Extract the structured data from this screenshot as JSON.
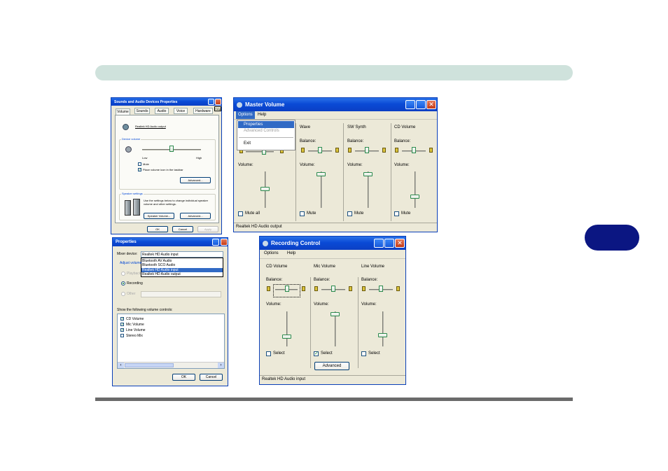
{
  "sounds": {
    "title": "Sounds and Audio Devices Properties",
    "help": "Help",
    "tabs": [
      "Volume",
      "Sounds",
      "Audio",
      "Voice",
      "Hardware"
    ],
    "device": "Realtek HD Audio output",
    "device_volume": "Device volume",
    "low": "Low",
    "high": "High",
    "mute": "Mute",
    "place_icon": "Place volume icon in the taskbar",
    "advanced": "Advanced...",
    "speaker_settings": "Speaker settings",
    "speaker_text": "Use the settings below to change individual speaker volume and other settings.",
    "speaker_volume": "Speaker Volume...",
    "advanced2": "Advanced...",
    "ok": "OK",
    "cancel": "Cancel",
    "apply": "Apply"
  },
  "master": {
    "title": "Master Volume",
    "menu": [
      "Options",
      "Help"
    ],
    "dropdown": [
      "Properties",
      "Advanced Controls",
      "Exit"
    ],
    "columns": [
      "Wave",
      "SW Synth",
      "CD Volume"
    ],
    "balance": "Balance:",
    "volume": "Volume:",
    "mute_all": "Mute all",
    "mute": "Mute",
    "status": "Realtek HD Audio output"
  },
  "props": {
    "title": "Properties",
    "mixer_label": "Mixer device:",
    "mixer_value": "Realtek HD Audio input",
    "mixer_options": [
      "Bluetooth AV Audio",
      "Bluetooth SCO Audio",
      "Realtek HD Audio input",
      "Realtek HD Audio output"
    ],
    "adjust": "Adjust volume",
    "playback": "Playback",
    "recording": "Recording",
    "other": "Other",
    "show": "Show the following volume controls:",
    "controls": [
      "CD Volume",
      "Mic Volume",
      "Line Volume",
      "Stereo Mix"
    ],
    "ok": "OK",
    "cancel": "Cancel"
  },
  "recording": {
    "title": "Recording Control",
    "menu": [
      "Options",
      "Help"
    ],
    "columns": [
      "CD Volume",
      "Mic Volume",
      "Line Volume"
    ],
    "balance": "Balance:",
    "volume": "Volume:",
    "select": "Select",
    "advanced": "Advanced",
    "status": "Realtek HD Audio input"
  }
}
